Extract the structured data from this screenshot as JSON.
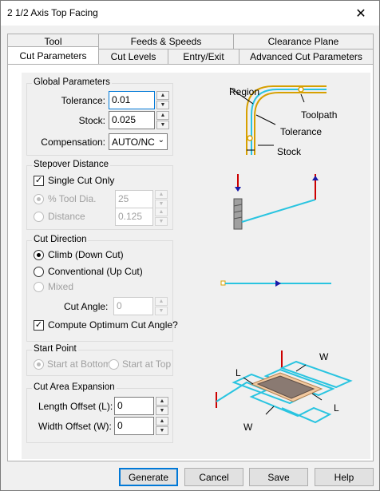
{
  "window": {
    "title": "2 1/2 Axis Top Facing",
    "close_glyph": "✕"
  },
  "tabs_row1": [
    "Tool",
    "Feeds & Speeds",
    "Clearance Plane"
  ],
  "tabs_row2": [
    "Cut Parameters",
    "Cut Levels",
    "Entry/Exit",
    "Advanced Cut Parameters"
  ],
  "global_params": {
    "title": "Global Parameters",
    "tolerance_label": "Tolerance:",
    "tolerance_value": "0.01",
    "stock_label": "Stock:",
    "stock_value": "0.025",
    "compensation_label": "Compensation:",
    "compensation_value": "AUTO/NC"
  },
  "stepover": {
    "title": "Stepover Distance",
    "single_cut_label": "Single Cut Only",
    "single_cut_checked": true,
    "tool_dia_label": "% Tool Dia.",
    "tool_dia_value": "25",
    "distance_label": "Distance",
    "distance_value": "0.125"
  },
  "cut_direction": {
    "title": "Cut Direction",
    "climb_label": "Climb (Down Cut)",
    "conventional_label": "Conventional (Up Cut)",
    "mixed_label": "Mixed",
    "cut_angle_label": "Cut Angle:",
    "cut_angle_value": "0",
    "compute_label": "Compute Optimum Cut Angle?",
    "compute_checked": true
  },
  "start_point": {
    "title": "Start Point",
    "bottom_label": "Start at Bottom",
    "top_label": "Start at Top"
  },
  "expansion": {
    "title": "Cut Area Expansion",
    "length_label": "Length Offset (L):",
    "length_value": "0",
    "width_label": "Width Offset (W):",
    "width_value": "0"
  },
  "diagram": {
    "region": "Region",
    "toolpath": "Toolpath",
    "tolerance": "Tolerance",
    "stock": "Stock",
    "w": "W",
    "l": "L"
  },
  "buttons": {
    "generate": "Generate",
    "cancel": "Cancel",
    "save": "Save",
    "help": "Help"
  },
  "icons": {
    "spin_up": "up-arrow-icon",
    "spin_down": "down-arrow-icon",
    "dropdown": "chevron-down-icon",
    "check": "checkmark-icon"
  },
  "colors": {
    "accent": "#0078d7",
    "toolpath": "#29c4e0",
    "region": "#d7a000",
    "stock": "#f2c9a0",
    "marker": "#cc0000",
    "arrow": "#1a1aa8"
  }
}
